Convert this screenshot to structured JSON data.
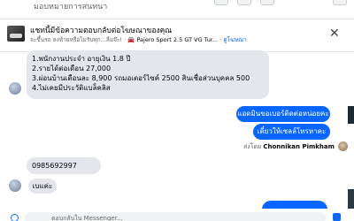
{
  "header": {
    "title": "มอบหมายการสนทนา"
  },
  "banner": {
    "title": "แชทนี้มีข้อความตอบกลับต่อโฆษณาของคุณ",
    "subtitle_prefix": "จะขึ้นรถ ลงท้ายหรือไม่รับทุก...ลืมจ๊ะ!",
    "car_name": "🚘 Pajero Sport 2.5 GT VG Tur...",
    "link": "ดูโฆษณา",
    "close_icon": "close-icon"
  },
  "messages": {
    "incoming_1": [
      "1.พนักงานประจำ อายุเงิน 1.8 ปี",
      "2.รายได้ต่อเดือน 27,000",
      "3.ผ่อนบ้านเดือนละ 8,900 รถมอเตอร์ไซค์ 2500 สินเชื่อส่วนบุคคล 500",
      "4.ไม่เคยมีประวัติแบล็คลิส"
    ],
    "outgoing_1": "แอดมินขอเบอร์ติดต่อหน่อยคะ",
    "outgoing_2": "เดี๋ยวให้เซลล์โทรหาคะ",
    "sent_by_prefix": "ส่งโดย",
    "sent_by_name": "Chonnikan Pimkham",
    "incoming_phone": "0985692997",
    "incoming_2": "เบแค่ะ"
  },
  "composer": {
    "placeholder": "ตอบกลับใน Messenger..."
  }
}
